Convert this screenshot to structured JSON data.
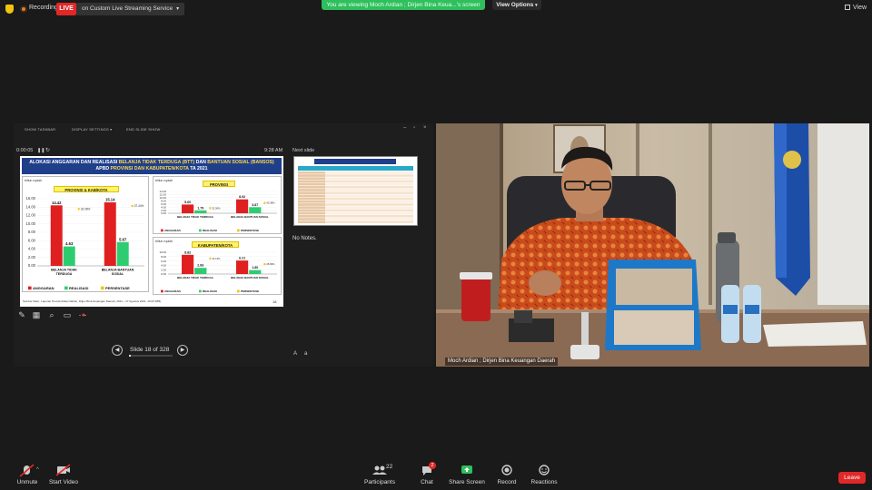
{
  "topbar": {
    "recording_label": "Recording",
    "live_label": "LIVE",
    "stream_label": "on Custom Live Streaming Service",
    "viewing_banner": "You are viewing Moch Ardian ; Dirjen Bina Keua...'s screen",
    "view_options_label": "View Options",
    "view_label": "View"
  },
  "presenter_view": {
    "toolbar": {
      "show_taskbar": "SHOW TASKBAR",
      "display_settings": "DISPLAY SETTINGS ▾",
      "end_slide_show": "END SLIDE SHOW"
    },
    "elapsed_time": "0:00:05",
    "clock": "9:28 AM",
    "next_slide_label": "Next slide",
    "notes_text": "No Notes.",
    "slide_counter": "Slide 18 of 328",
    "progress_fraction": 0.05
  },
  "slide": {
    "title_line1_a": "ALOKASI ANGGARAN DAN REALISASI ",
    "title_line1_b": "BELANJA TIDAK TERDUGA (BTT)",
    "title_line1_c": " DAN ",
    "title_line1_d": "BANTUAN SOSIAL (BANSOS)",
    "title_line2_a": "APBD ",
    "title_line2_b": "PROVINSI DAN KABUPATEN/KOTA",
    "title_line2_c": " TA 2021",
    "slide_number": "18",
    "source_text": "Sumber Data : Laporan Pemda (Data Olahan, Ditjen Bina Keuangan Daerah, 2021 – 27 Agustus 2021, 19.00 WIB)"
  },
  "chart_data": [
    {
      "type": "bar",
      "title": "PROVINSI & KAB/KOTA",
      "unit": "triliun rupiah",
      "categories": [
        "BELANJA TIDAK TERDUGA",
        "BELANJA BANTUAN SOSIAL"
      ],
      "series": [
        {
          "name": "ANGGARAN",
          "values": [
            14.42,
            15.14
          ],
          "color": "#e02020"
        },
        {
          "name": "REALISASI",
          "values": [
            4.63,
            5.67
          ],
          "color": "#2ecc71"
        }
      ],
      "percentages": [
        "32.08%",
        "37.44%"
      ],
      "percent_series_name": "PERSENTASE",
      "yticks": [
        "0.00",
        "2.00",
        "4.00",
        "6.00",
        "8.00",
        "10.00",
        "12.00",
        "14.00",
        "16.00"
      ],
      "ylim": [
        0,
        16
      ]
    },
    {
      "type": "bar",
      "title": "PROVINSI",
      "unit": "triliun rupiah",
      "categories": [
        "BELANJA TIDAK TERDUGA",
        "BELANJA BANTUAN SOSIAL"
      ],
      "series": [
        {
          "name": "ANGGARAN",
          "values": [
            5.6,
            8.92
          ],
          "color": "#e02020"
        },
        {
          "name": "REALISASI",
          "values": [
            1.79,
            3.87
          ],
          "color": "#2ecc71"
        }
      ],
      "percentages": [
        "31.96%",
        "43.38%"
      ],
      "percent_series_name": "PERSENTASE",
      "yticks": [
        "0.00",
        "2.00",
        "4.00",
        "6.00",
        "8.00",
        "10.00",
        "12.00",
        "14.00"
      ],
      "ylim": [
        0,
        14
      ]
    },
    {
      "type": "bar",
      "title": "KABUPATEN/KOTA",
      "unit": "triliun rupiah",
      "categories": [
        "BELANJA TIDAK TERDUGA",
        "BELANJA BANTUAN SOSIAL"
      ],
      "series": [
        {
          "name": "ANGGARAN",
          "values": [
            8.82,
            6.21
          ],
          "color": "#e02020"
        },
        {
          "name": "REALISASI",
          "values": [
            2.83,
            1.8
          ],
          "color": "#2ecc71"
        }
      ],
      "percentages": [
        "32.13%",
        "28.99%"
      ],
      "percent_series_name": "PERSENTASE",
      "yticks": [
        "0.00",
        "2.00",
        "4.00",
        "6.00",
        "8.00",
        "10.00"
      ],
      "ylim": [
        0,
        10
      ]
    }
  ],
  "video": {
    "participant_name": "Moch Ardian ; Dirjen Bina Keuangan Daerah"
  },
  "bottombar": {
    "unmute": "Unmute",
    "start_video": "Start Video",
    "participants": "Participants",
    "participants_count": "22",
    "chat": "Chat",
    "chat_badge": "2",
    "share_screen": "Share Screen",
    "record": "Record",
    "reactions": "Reactions",
    "leave": "Leave"
  }
}
